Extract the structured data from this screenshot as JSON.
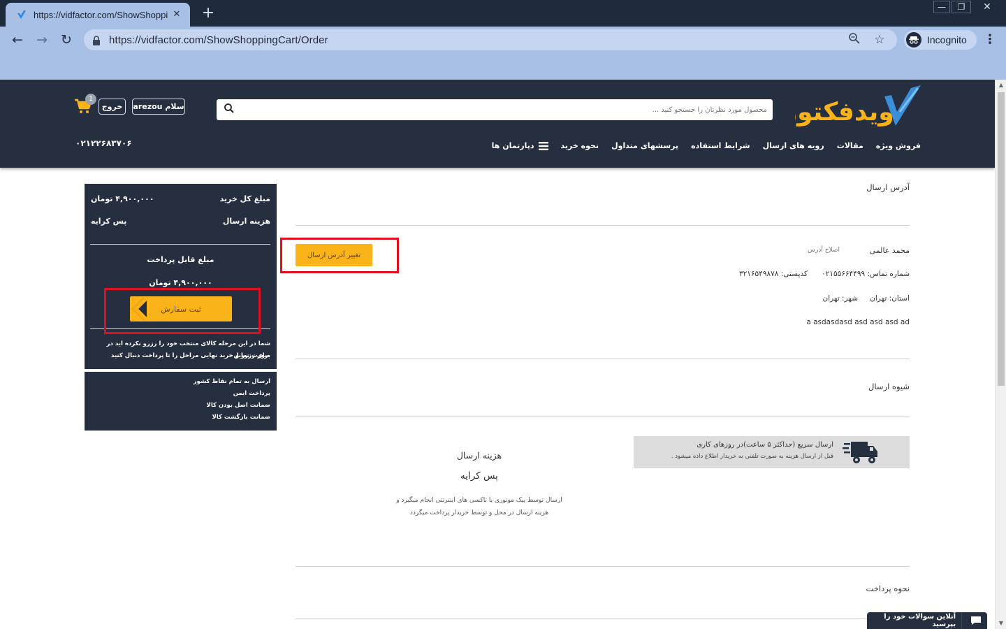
{
  "browser": {
    "tab_title": "https://vidfactor.com/ShowShoppi",
    "tab_close": "✕",
    "new_tab": "+",
    "url": "https://vidfactor.com/ShowShoppingCart/Order",
    "incognito_label": "Incognito",
    "win_min": "—",
    "win_max": "❐",
    "win_close": "✕"
  },
  "header": {
    "search_placeholder": "محصول مورد نظرتان را جستجو کنید ...",
    "hello_button": "سلام arezou",
    "logout_button": "خروج",
    "cart_count": "1",
    "phone": "۰۲۱۲۲۶۸۳۷۰۶",
    "logo_text": "ویدفکتور",
    "nav": [
      "دپارتمان ها",
      "نحوه خرید",
      "پرسشهای متداول",
      "شرایط استفاده",
      "رویه های ارسال",
      "مقالات",
      "فروش ویژه"
    ]
  },
  "summary": {
    "total_label": "مبلغ کل خرید",
    "total_value": "۴,۹۰۰,۰۰۰ تومان",
    "shipping_label": "هزینه ارسال",
    "shipping_value": "پس کرایه",
    "payable_label": "مبلغ قابل پرداخت",
    "payable_value": "۴,۹۰۰,۰۰۰ تومان",
    "order_button": "ثبت سفارش",
    "note_line1": "شما در این مرحله کالای منتخب خود را رزرو نکرده اید در صورت تمایل",
    "note_line2": "برای رزرو و خرید نهایی مراحل را تا پرداخت دنبال کنید"
  },
  "features": [
    "ارسال به تمام نقاط کشور",
    "پرداخت ایمن",
    "ضمانت اصل بودن کالا",
    "ضمانت بازگشت کالا"
  ],
  "address": {
    "section_title": "آدرس ارسال",
    "name": "محمد عالمی",
    "edit_link": "اصلاح آدرس",
    "change_button": "تغییر آدرس ارسال",
    "phone_line": "شماره تماس: ۰۲۱۵۵۶۶۴۴۹۹",
    "postal_line": "کدپستی: ۳۲۱۶۵۴۹۸۷۸",
    "province_line": "استان: تهران",
    "city_line": "شهر: تهران",
    "street": "a asdasdasd asd asd asd ad"
  },
  "shipping": {
    "section_title": "شیوه ارسال",
    "method_title": "ارسال سریع (حداکثر ۵ ساعت)در روزهای کاری",
    "method_desc": "قبل از ارسال هزینه به صورت تلفنی به خریدار اطلاع داده میشود .",
    "cost_label": "هزینه ارسال",
    "cost_value": "پس کرایه",
    "cost_desc1": "ارسال توسط پیک موتوری یا تاکسی های اینترنتی انجام میگیرد و",
    "cost_desc2": "هزینه ارسال در محل و توسط خریدار پرداخت میگردد"
  },
  "payment": {
    "section_title": "نحوه پرداخت"
  },
  "chat": {
    "label": "آنلاین سوالات خود را بپرسید"
  },
  "colors": {
    "header_bg": "#252f3f",
    "accent_yellow": "#fbb31a",
    "highlight_red": "#e01020",
    "browser_chrome": "#a9c0e6"
  }
}
